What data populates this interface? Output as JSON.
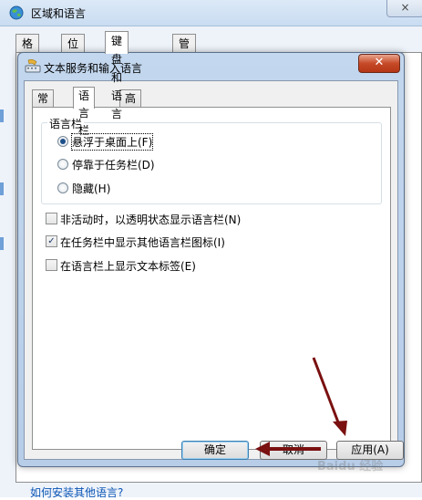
{
  "background_window": {
    "title": "区域和语言",
    "close_label": "×",
    "tabs": [
      "格式",
      "位置",
      "键盘和语言",
      "管理"
    ],
    "active_tab": "键盘和语言",
    "link": "如何安装其他语言?"
  },
  "dialog": {
    "title": "文本服务和输入语言",
    "close_label": "✕",
    "tabs": [
      "常规",
      "语言栏",
      "高级键设置"
    ],
    "active_tab": "语言栏",
    "group_title": "语言栏",
    "radio_options": [
      {
        "label": "悬浮于桌面上(F)",
        "checked": true
      },
      {
        "label": "停靠于任务栏(D)",
        "checked": false
      },
      {
        "label": "隐藏(H)",
        "checked": false
      }
    ],
    "checkboxes": [
      {
        "label": "非活动时，以透明状态显示语言栏(N)",
        "checked": false
      },
      {
        "label": "在任务栏中显示其他语言栏图标(I)",
        "checked": true
      },
      {
        "label": "在语言栏上显示文本标签(E)",
        "checked": false
      }
    ],
    "buttons": {
      "ok": "确定",
      "cancel": "取消",
      "apply": "应用(A)"
    }
  },
  "watermark": "Baidu 经验",
  "colors": {
    "arrow": "#7a1010",
    "dialog_frame": "#b7cde8",
    "close_button": "#c74a28"
  }
}
